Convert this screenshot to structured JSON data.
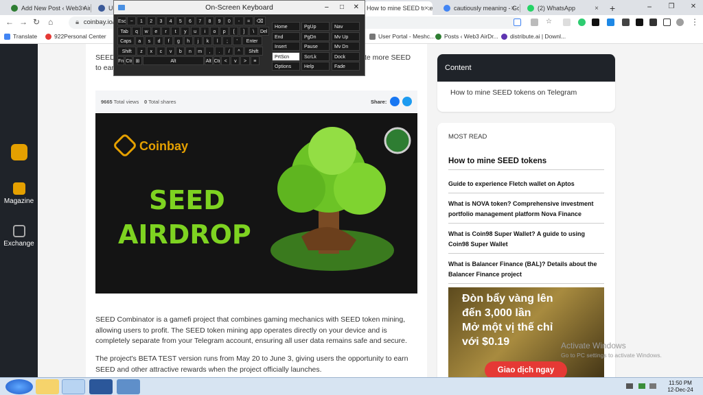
{
  "browser": {
    "tabs": [
      {
        "label": "Add New Post ‹ Web3 AirDr",
        "color": "#2e7d32"
      },
      {
        "label": "Use",
        "color": "#3b5998"
      },
      {
        "label": "How to mine SEED tokens",
        "color": "#e5a000"
      },
      {
        "label": "cautiously meaning - Goo",
        "color": "#4285f4"
      },
      {
        "label": "(2) WhatsApp",
        "color": "#25d366"
      }
    ],
    "new_tab": "+",
    "tab_close": "×",
    "window_minimize": "−",
    "window_maximize": "❐",
    "window_close": "✕",
    "url": "coinbay.io/en",
    "bookmarks": [
      {
        "label": "Translate"
      },
      {
        "label": "922Personal Center"
      },
      {
        "label": "User Portal - Meshc..."
      },
      {
        "label": "Posts ‹ Web3 AirDr..."
      },
      {
        "label": "distribute.ai | Downl..."
      }
    ]
  },
  "osk": {
    "title": "On-Screen Keyboard",
    "rows": [
      [
        "Esc",
        "~",
        "1",
        "2",
        "3",
        "4",
        "5",
        "6",
        "7",
        "8",
        "9",
        "0",
        "-",
        "=",
        "⌫"
      ],
      [
        "Tab",
        "q",
        "w",
        "e",
        "r",
        "t",
        "y",
        "u",
        "i",
        "o",
        "p",
        "[",
        "]",
        "\\",
        "Del"
      ],
      [
        "Caps",
        "a",
        "s",
        "d",
        "f",
        "g",
        "h",
        "j",
        "k",
        "l",
        ";",
        "'",
        "Enter"
      ],
      [
        "Shift",
        "z",
        "x",
        "c",
        "v",
        "b",
        "n",
        "m",
        ",",
        ".",
        "/",
        "^",
        "Shift"
      ],
      [
        "Fn",
        "Ctrl",
        "⊞",
        "Alt",
        "Alt",
        "Ctrl",
        "<",
        "v",
        ">",
        "≡"
      ]
    ],
    "side_keys": [
      [
        "Home",
        "PgUp",
        "Nav"
      ],
      [
        "End",
        "PgDn",
        "Mv Up"
      ],
      [
        "Insert",
        "Pause",
        "Mv Dn"
      ],
      [
        "PrtScn",
        "ScrLk",
        "Dock"
      ],
      [
        "Options",
        "Help",
        "Fade"
      ]
    ],
    "highlighted_key": "PrtScn"
  },
  "leftnav": {
    "items": [
      {
        "label": ""
      },
      {
        "label": "Magazine"
      },
      {
        "label": "Exchange"
      }
    ]
  },
  "article": {
    "intro_fragment_1": "SEED",
    "intro_fragment_2": "te more SEED",
    "intro_fragment_3": "to ear",
    "views_count": "9665",
    "views_label": "Total views",
    "shares_count": "0",
    "shares_label": "Total shares",
    "share_label": "Share:",
    "banner": {
      "brand": "Coinbay",
      "line1": "SEED",
      "line2": "AIRDROP"
    },
    "para1": "SEED Combinator is a gamefi project that combines gaming mechanics with SEED token mining, allowing users to profit. The SEED token mining app operates directly on your device and is completely separate from your Telegram account, ensuring all user data remains safe and secure.",
    "para2": "The project's BETA TEST version runs from May 20 to June 3, giving users the opportunity to earn SEED and other attractive rewards when the project officially launches."
  },
  "sidebar": {
    "content_title": "Content",
    "content_link": "How to mine SEED tokens on Telegram",
    "most_read_label": "MOST READ",
    "featured": "How to mine SEED tokens",
    "items": [
      "Guide to experience Fletch wallet on Aptos",
      "What is NOVA token? Comprehensive investment portfolio management platform Nova Finance",
      "What is Coin98 Super Wallet? A guide to using Coin98 Super Wallet",
      "What is Balancer Finance (BAL)? Details about the Balancer Finance project"
    ],
    "ad": {
      "line1": "Đòn bẩy vàng lên",
      "line2": "đến 3,000 lần",
      "line3": "Mở một vị thế chỉ",
      "line4": "với $0.19",
      "button": "Giao dịch ngay"
    }
  },
  "watermark": {
    "line1": "Activate Windows",
    "line2": "Go to PC settings to activate Windows."
  },
  "taskbar": {
    "time": "11:50 PM",
    "date": "12-Dec-24"
  },
  "colors": {
    "nav_dark": "#1f2329",
    "seed_green": "#7ed321",
    "coinbay_gold": "#e5a000",
    "ad_button": "#e53935"
  }
}
